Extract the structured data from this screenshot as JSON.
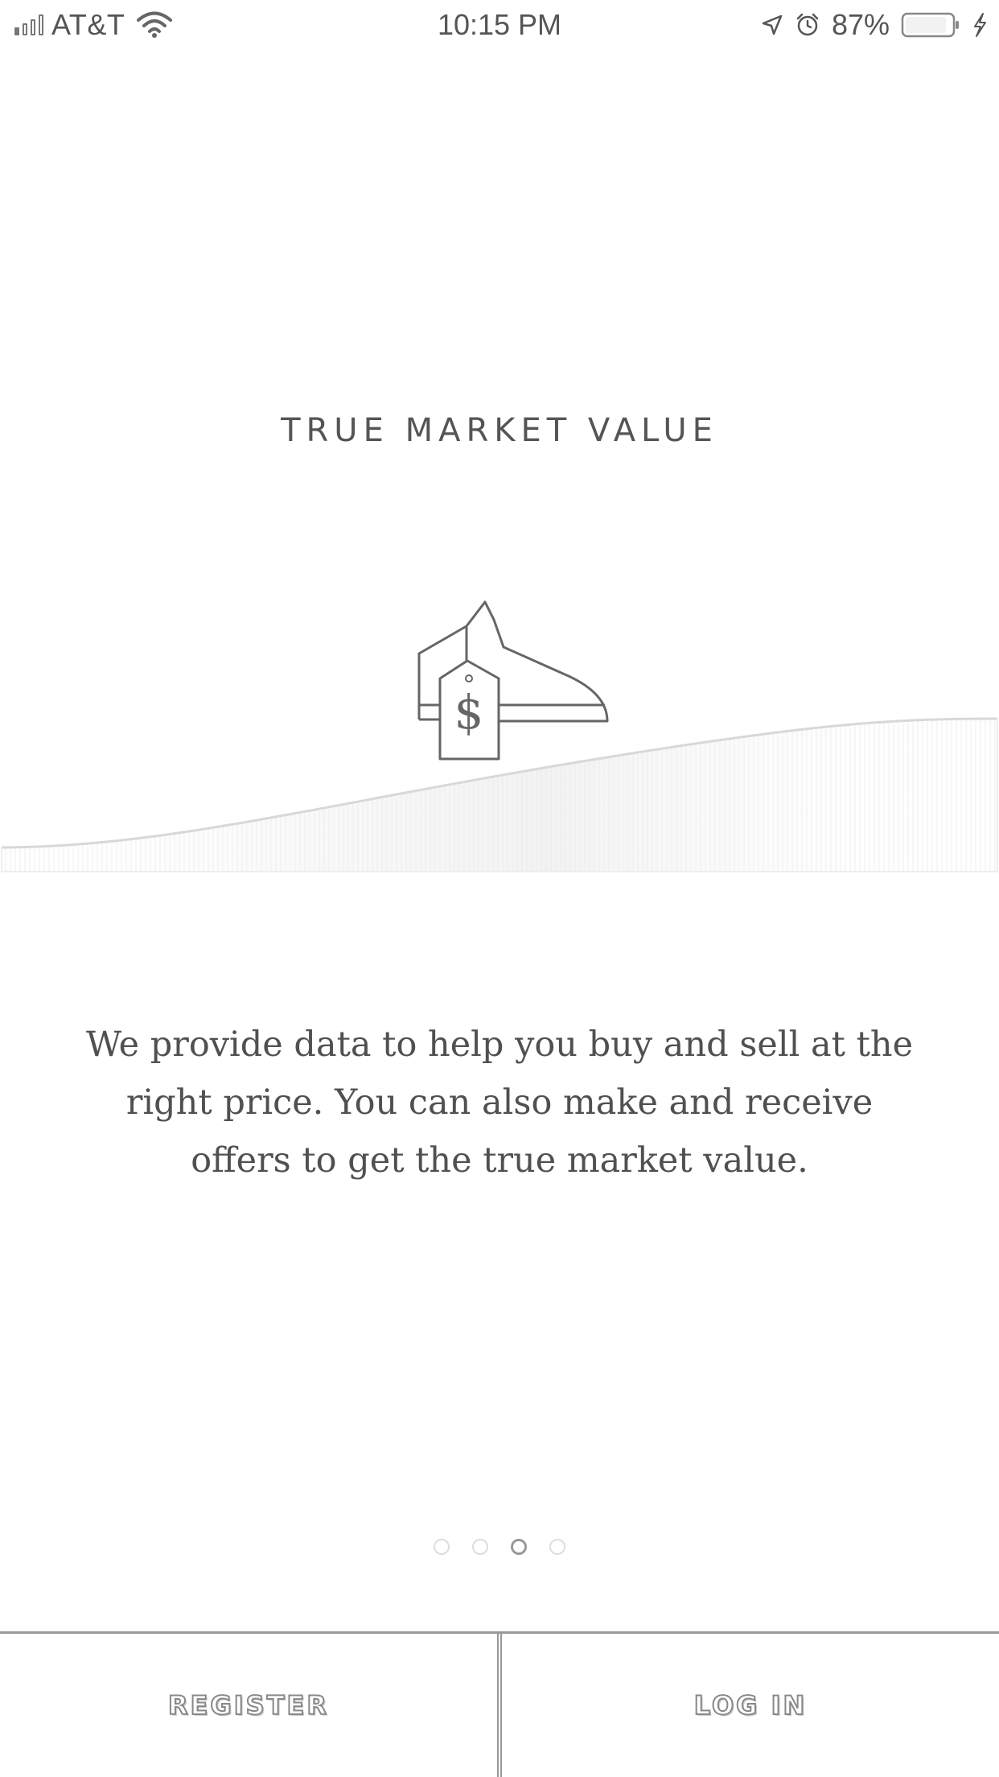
{
  "status_bar": {
    "carrier": "AT&T",
    "time": "10:15 PM",
    "battery_percent": "87%",
    "icons": [
      "signal-icon",
      "wifi-icon",
      "location-arrow-icon",
      "alarm-icon",
      "battery-icon",
      "charging-bolt-icon"
    ]
  },
  "onboarding": {
    "title": "TRUE MARKET VALUE",
    "illustration_icons": [
      "sneaker-icon",
      "price-tag-icon",
      "market-curve"
    ],
    "price_tag_symbol": "$",
    "description": "We provide data to help you buy and sell at the right price. You can also make and receive offers to get the true market value.",
    "pages_total": 4,
    "active_page_index": 2
  },
  "actions": {
    "register_label": "REGISTER",
    "login_label": "LOG IN"
  },
  "colors": {
    "background": "#ffffff",
    "text": "#555555",
    "line": "#999999"
  }
}
